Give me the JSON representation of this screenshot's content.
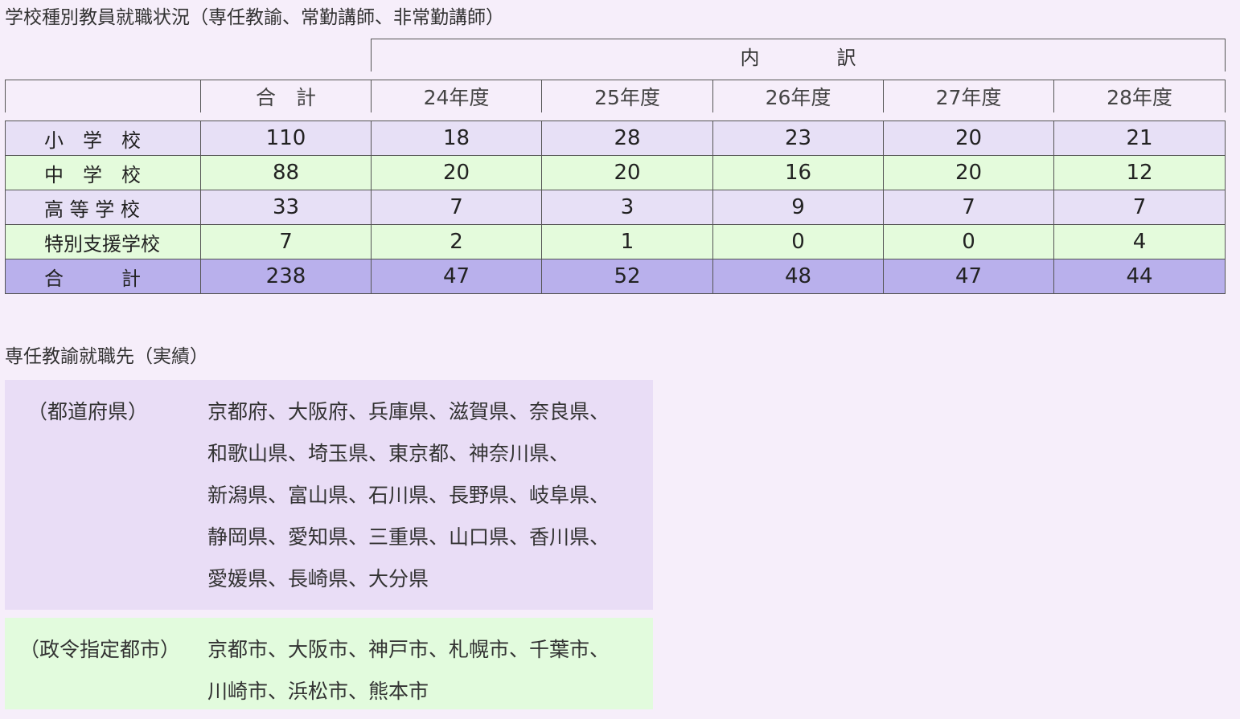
{
  "section1": {
    "title": "学校種別教員就職状況（専任教諭、常勤講師、非常勤講師）",
    "breakdown_label": "内　訳",
    "columns": [
      "合　計",
      "24年度",
      "25年度",
      "26年度",
      "27年度",
      "28年度"
    ],
    "rows": [
      {
        "label": "小　学　校",
        "values": [
          "110",
          "18",
          "28",
          "23",
          "20",
          "21"
        ]
      },
      {
        "label": "中　学　校",
        "values": [
          "88",
          "20",
          "20",
          "16",
          "20",
          "12"
        ]
      },
      {
        "label": "高 等 学 校",
        "values": [
          "33",
          "7",
          "3",
          "9",
          "7",
          "7"
        ]
      },
      {
        "label": "特別支援学校",
        "values": [
          "7",
          "2",
          "1",
          "0",
          "0",
          "4"
        ]
      },
      {
        "label": "合　　　計",
        "values": [
          "238",
          "47",
          "52",
          "48",
          "47",
          "44"
        ]
      }
    ]
  },
  "section2": {
    "title": "専任教諭就職先（実績）",
    "prefectures": {
      "label": "（都道府県）",
      "lines": [
        "京都府、大阪府、兵庫県、滋賀県、奈良県、",
        "和歌山県、埼玉県、東京都、神奈川県、",
        "新潟県、富山県、石川県、長野県、岐阜県、",
        "静岡県、愛知県、三重県、山口県、香川県、",
        "愛媛県、長崎県、大分県"
      ]
    },
    "cities": {
      "label": "（政令指定都市）",
      "lines": [
        "京都市、大阪市、神戸市、札幌市、千葉市、",
        "川崎市、浜松市、熊本市"
      ]
    }
  },
  "colors": {
    "background": "#f6eefa",
    "row_purple": "#e7e0f6",
    "row_green": "#e4fbdc",
    "row_total": "#b9b0ec",
    "box_purple": "#e9ddf6",
    "box_green": "#e2fbdd"
  }
}
